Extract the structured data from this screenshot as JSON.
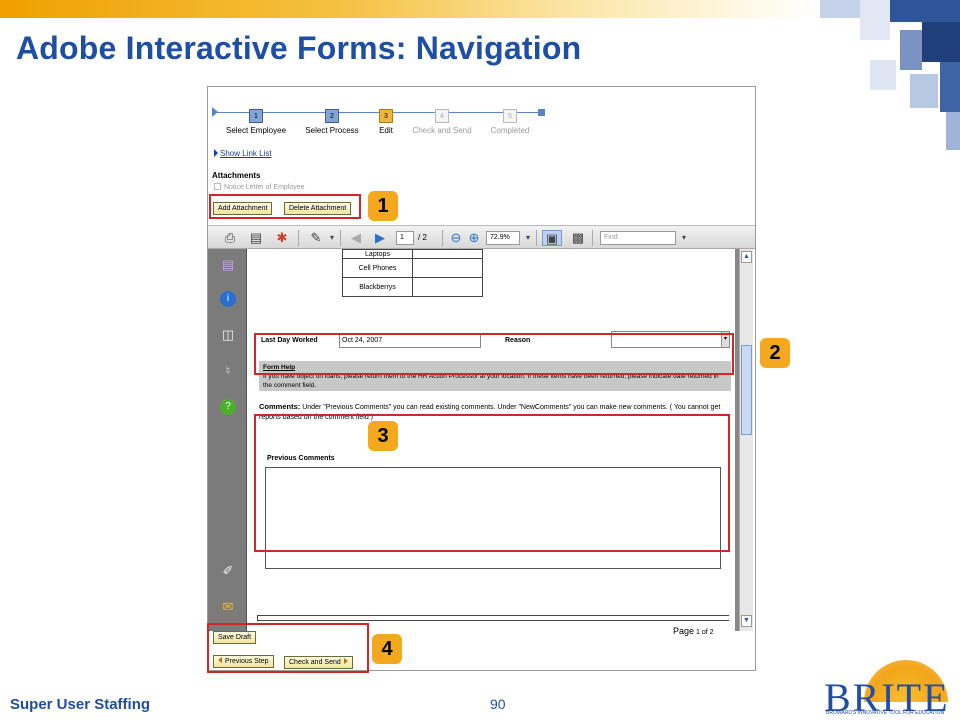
{
  "slide": {
    "title": "Adobe Interactive Forms: Navigation",
    "footer_left": "Super User Staffing",
    "page_number": "90",
    "logo_text": "BRITE",
    "logo_tagline": "BROWARD'S INNOVATIVE TOOL FOR EDUCATION"
  },
  "roadmap": {
    "steps": [
      {
        "number": "1",
        "label": "Select Employee",
        "state": "done"
      },
      {
        "number": "2",
        "label": "Select Process",
        "state": "done"
      },
      {
        "number": "3",
        "label": "Edit",
        "state": "active"
      },
      {
        "number": "4",
        "label": "Check and Send",
        "state": "future"
      },
      {
        "number": "5",
        "label": "Completed",
        "state": "future"
      }
    ]
  },
  "links": {
    "show_link_list": "Show Link List"
  },
  "attachments": {
    "title": "Attachments",
    "item": "Notice Letter of Employee",
    "add_button": "Add Attachment",
    "delete_button": "Delete Attachment"
  },
  "pdf_toolbar": {
    "page_current": "1",
    "page_total": "/ 2",
    "zoom": "72.9%",
    "find_placeholder": "Find"
  },
  "form": {
    "items": [
      "Laptops",
      "Cell Phones",
      "Blackberrys"
    ],
    "last_day_label": "Last Day Worked",
    "last_day_value": "Oct 24, 2007",
    "reason_label": "Reason",
    "form_help_title": "Form Help",
    "form_help_text": "If you have object on loans, please return them to the HR Action Processor at your location. If these items have been returned, please indicate date returned in the comment field.",
    "comments_label": "Comments:",
    "comments_text": "Under \"Previous Comments\" you can read existing comments. Under \"NewComments\" you can make new comments. ( You cannot get reports based on the comment field )",
    "previous_comments_label": "Previous Comments",
    "page_label": "Page",
    "page_of": "1 of 2"
  },
  "bottom_buttons": {
    "save_draft": "Save Draft",
    "previous_step": "Previous Step",
    "check_and_send": "Check and Send"
  },
  "callouts": [
    "1",
    "2",
    "3",
    "4"
  ],
  "colors": {
    "title": "#1f4fa3",
    "callout": "#f3a81d",
    "highlight_box": "#d42626",
    "active_step": "#f2b43a"
  }
}
